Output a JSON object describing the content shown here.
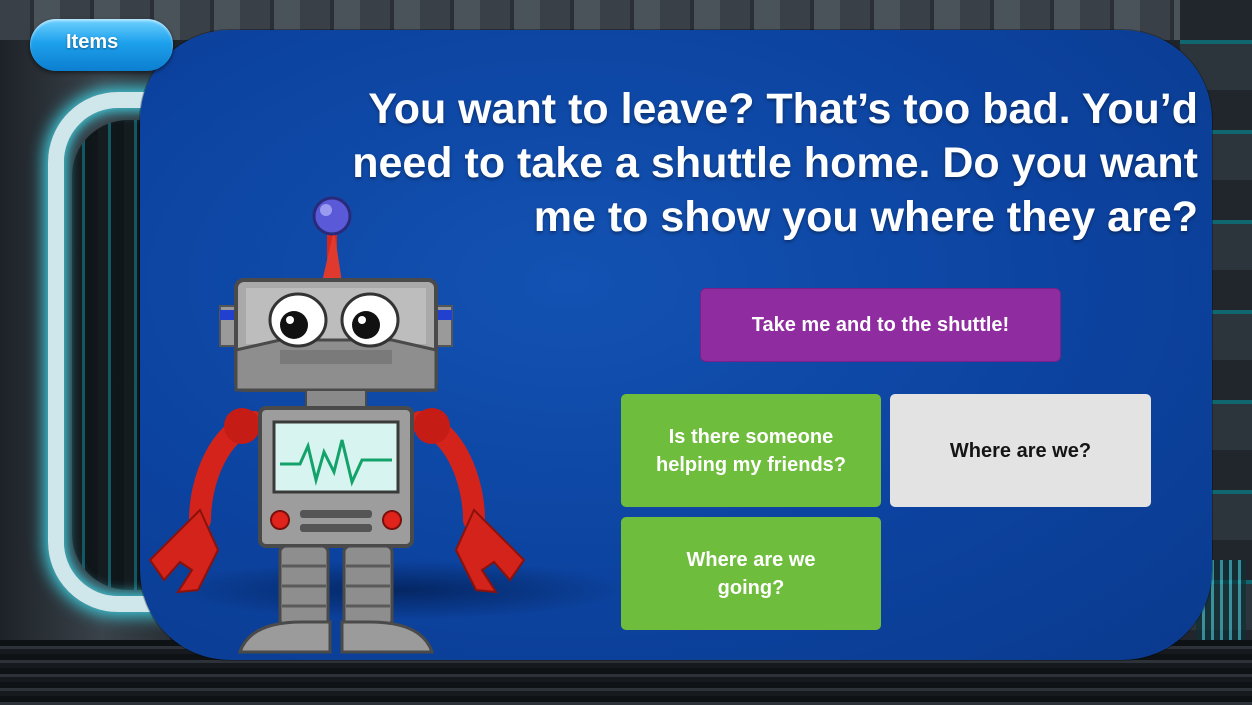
{
  "scene": {
    "items_button_label": "Items",
    "speech_lines": [
      "You want to leave? That’s too bad. You’d",
      "need to take a shuttle home. Do you want",
      "me to show you where they are?"
    ],
    "choices": {
      "shuttle": "Take me and  to the shuttle!",
      "friends_line1": "Is there someone",
      "friends_line2": "helping my friends?",
      "where": "Where are we?",
      "going_line1": "Where are we",
      "going_line2": "going?"
    }
  },
  "colors": {
    "panel": "#0c43a0",
    "choice_purple": "#8f2ca0",
    "choice_green": "#6fbd3c",
    "choice_gray": "#e3e3e3",
    "items_button": "#1ea1ec"
  },
  "icons": {
    "character": "robot-character-icon"
  }
}
